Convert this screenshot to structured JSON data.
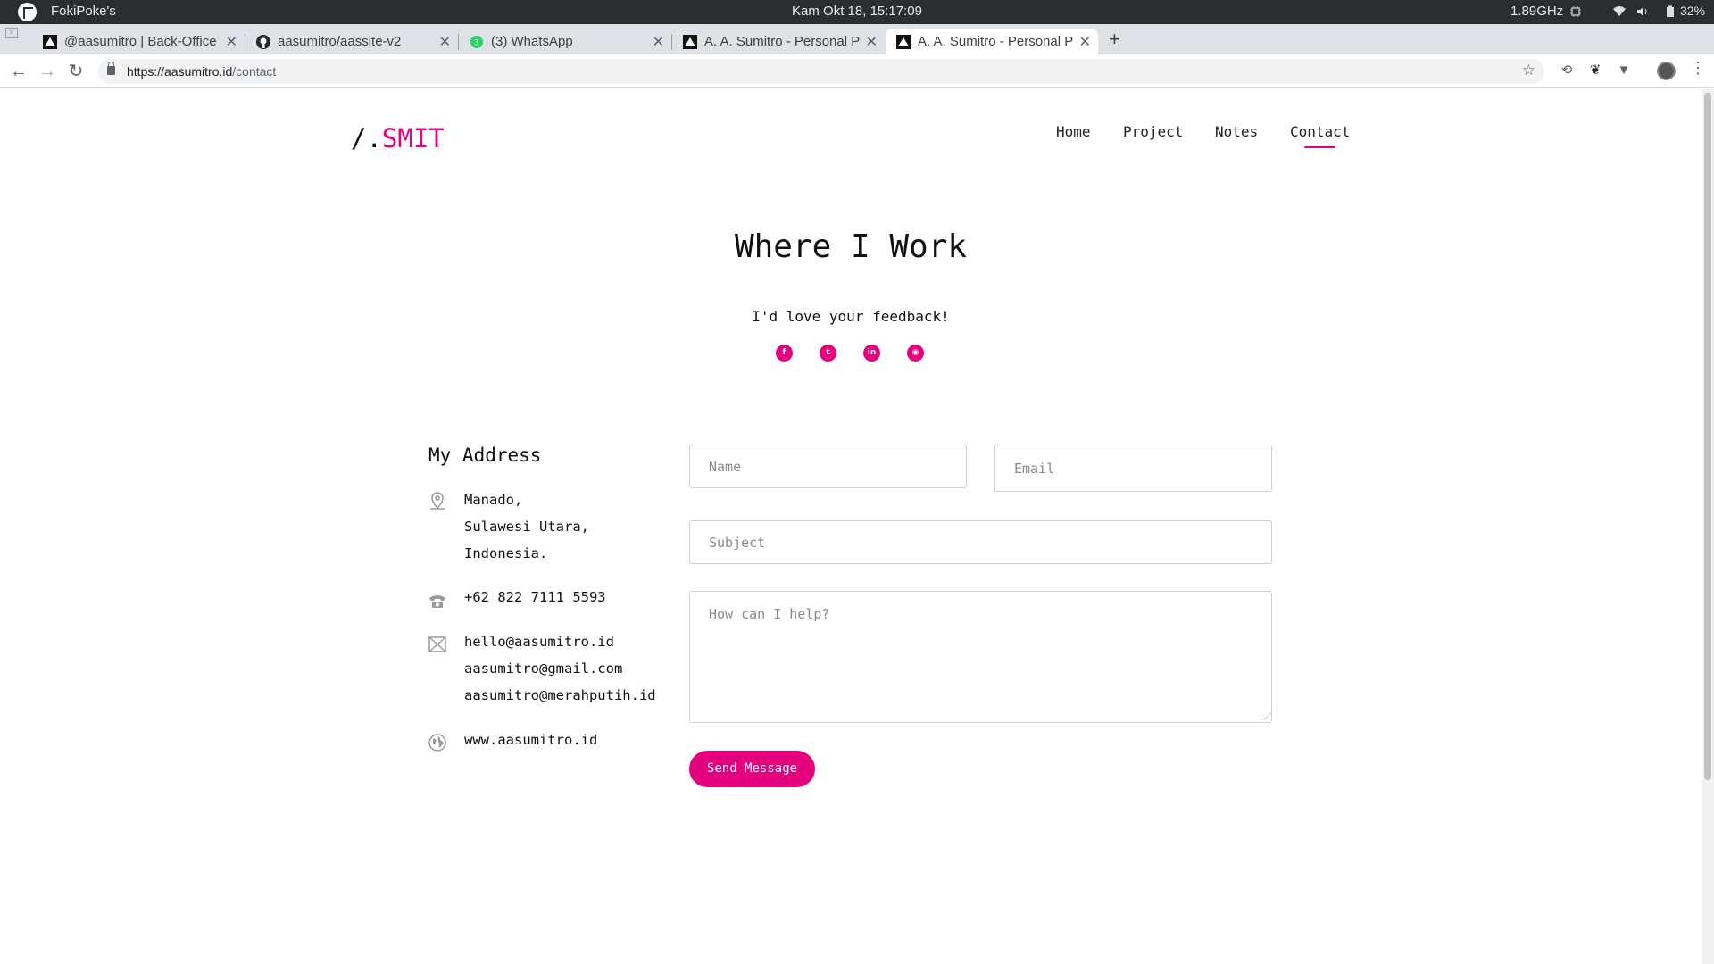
{
  "os": {
    "app_name": "FokiPoke's",
    "clock": "Kam Okt 18, 15:17:09",
    "cpu": "1.89GHz",
    "battery": "32%"
  },
  "browser": {
    "tabs": [
      {
        "title": "@aasumitro | Back-Office",
        "favicon": "vercel-icon",
        "active": false
      },
      {
        "title": "aasumitro/aassite-v2",
        "favicon": "github-icon",
        "active": false
      },
      {
        "title": "(3) WhatsApp",
        "favicon": "whatsapp-icon",
        "active": false
      },
      {
        "title": "A. A. Sumitro - Personal Pa",
        "favicon": "vercel-icon",
        "active": false
      },
      {
        "title": "A. A. Sumitro - Personal Pa",
        "favicon": "vercel-icon",
        "active": true
      }
    ],
    "url_host": "https://aasumitro.id",
    "url_path": "/contact"
  },
  "site": {
    "brand_prefix": "/.",
    "brand_name": "SMIT",
    "nav": [
      {
        "label": "Home",
        "active": false
      },
      {
        "label": "Project",
        "active": false
      },
      {
        "label": "Notes",
        "active": false
      },
      {
        "label": "Contact",
        "active": true
      }
    ],
    "title": "Where I Work",
    "subtitle": "I'd love your feedback!",
    "social": [
      {
        "icon": "facebook-icon",
        "glyph": "f"
      },
      {
        "icon": "twitter-icon",
        "glyph": "t"
      },
      {
        "icon": "linkedin-icon",
        "glyph": "in"
      },
      {
        "icon": "github-icon",
        "glyph": "◉"
      }
    ],
    "address": {
      "heading": "My Address",
      "location": [
        "Manado,",
        "Sulawesi Utara,",
        "Indonesia."
      ],
      "phone": "+62 822 7111 5593",
      "emails": [
        "hello@aasumitro.id",
        "aasumitro@gmail.com",
        "aasumitro@merahputih.id"
      ],
      "website": "www.aasumitro.id"
    },
    "form": {
      "name_placeholder": "Name",
      "email_placeholder": "Email",
      "subject_placeholder": "Subject",
      "message_placeholder": "How can I help?",
      "send_label": "Send Message"
    },
    "accent_color": "#e5007d"
  }
}
